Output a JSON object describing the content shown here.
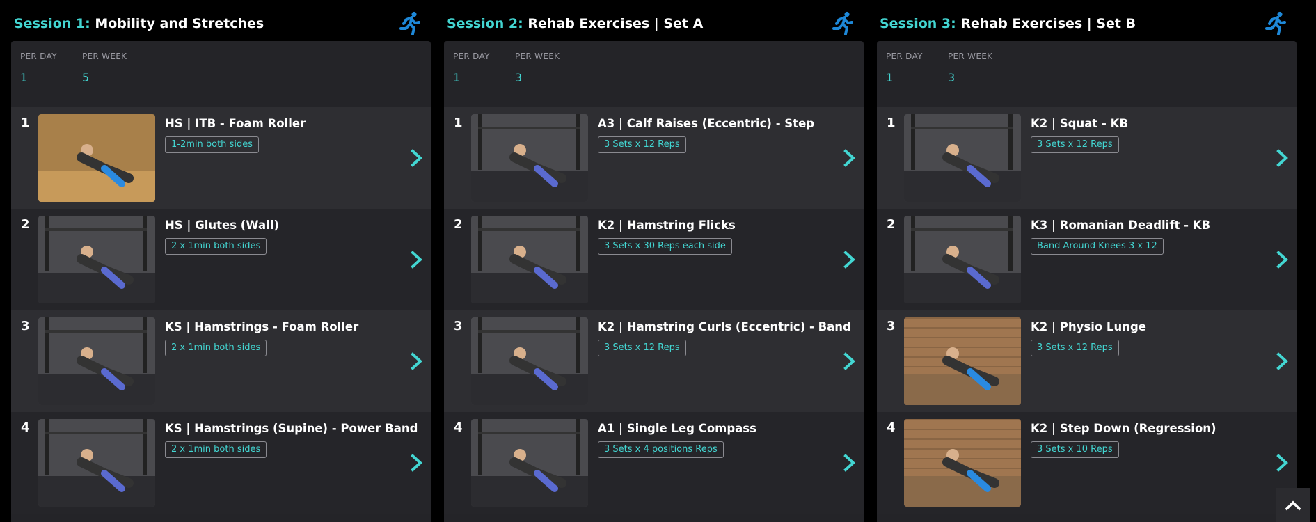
{
  "sessions": [
    {
      "number_label": "Session 1:",
      "title": "Mobility and Stretches",
      "icon": "running-person-icon",
      "per_day_label": "PER DAY",
      "per_day": "1",
      "per_week_label": "PER WEEK",
      "per_week": "5",
      "exercises": [
        {
          "index": "1",
          "name": "HS | ITB - Foam Roller",
          "prescription": "1-2min both sides",
          "thumb": "wood"
        },
        {
          "index": "2",
          "name": "HS | Glutes (Wall)",
          "prescription": "2 x 1min both sides",
          "thumb": "gym"
        },
        {
          "index": "3",
          "name": "KS | Hamstrings - Foam Roller",
          "prescription": "2 x 1min both sides",
          "thumb": "gym"
        },
        {
          "index": "4",
          "name": "KS | Hamstrings (Supine) - Power Band",
          "prescription": "2 x 1min both sides",
          "thumb": "gym"
        }
      ]
    },
    {
      "number_label": "Session 2:",
      "title": "Rehab Exercises | Set A",
      "icon": "running-person-icon",
      "per_day_label": "PER DAY",
      "per_day": "1",
      "per_week_label": "PER WEEK",
      "per_week": "3",
      "exercises": [
        {
          "index": "1",
          "name": "A3 | Calf Raises (Eccentric) - Step",
          "prescription": "3 Sets x 12 Reps",
          "thumb": "gym"
        },
        {
          "index": "2",
          "name": "K2 | Hamstring Flicks",
          "prescription": "3 Sets x 30 Reps each side",
          "thumb": "gym"
        },
        {
          "index": "3",
          "name": "K2 | Hamstring Curls (Eccentric) - Band",
          "prescription": "3 Sets x 12 Reps",
          "thumb": "gym"
        },
        {
          "index": "4",
          "name": "A1 | Single Leg Compass",
          "prescription": "3 Sets x 4 positions Reps",
          "thumb": "gym"
        }
      ]
    },
    {
      "number_label": "Session 3:",
      "title": "Rehab Exercises | Set B",
      "icon": "running-person-icon",
      "per_day_label": "PER DAY",
      "per_day": "1",
      "per_week_label": "PER WEEK",
      "per_week": "3",
      "exercises": [
        {
          "index": "1",
          "name": "K2 | Squat - KB",
          "prescription": "3 Sets x 12 Reps",
          "thumb": "gym"
        },
        {
          "index": "2",
          "name": "K3 | Romanian Deadlift - KB",
          "prescription": "Band Around Knees 3 x 12",
          "thumb": "gym"
        },
        {
          "index": "3",
          "name": "K2 | Physio Lunge",
          "prescription": "3 Sets x 12 Reps",
          "thumb": "deck"
        },
        {
          "index": "4",
          "name": "K2 | Step Down (Regression)",
          "prescription": "3 Sets x 10 Reps",
          "thumb": "deck"
        }
      ]
    }
  ],
  "colors": {
    "accent": "#43d6d2",
    "icon_blue": "#1e88d8",
    "panel": "#242428",
    "row": "#2e2e32",
    "row_alt": "#252529"
  },
  "scroll_top_icon": "chevron-up-icon"
}
